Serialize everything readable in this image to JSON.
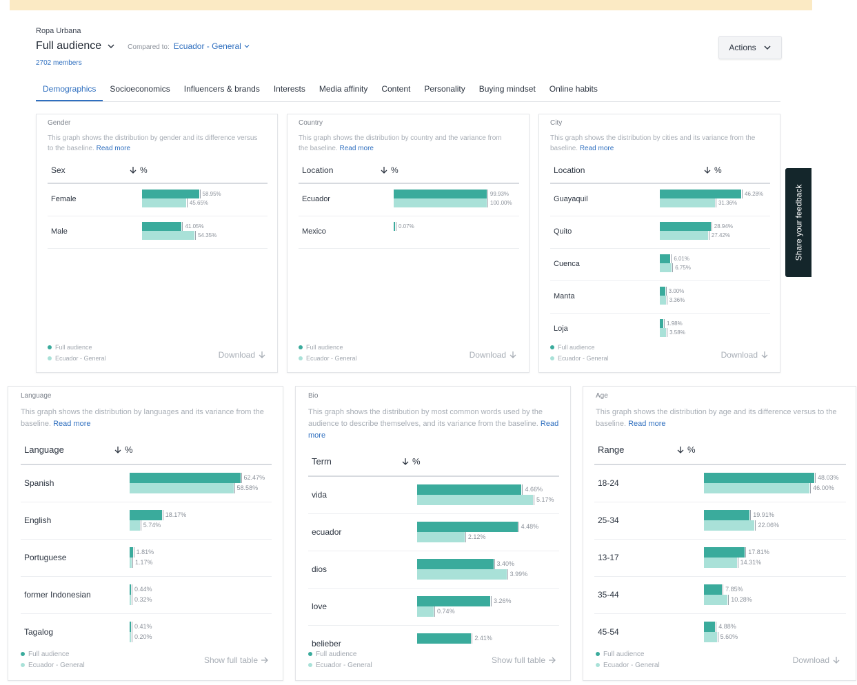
{
  "header": {
    "brand": "Ropa Urbana",
    "audience": "Full audience",
    "compared_label": "Compared to:",
    "compared_value": "Ecuador - General",
    "members": "2702 members",
    "actions_label": "Actions"
  },
  "tabs": [
    {
      "label": "Demographics",
      "active": true
    },
    {
      "label": "Socioeconomics",
      "active": false
    },
    {
      "label": "Influencers & brands",
      "active": false
    },
    {
      "label": "Interests",
      "active": false
    },
    {
      "label": "Media affinity",
      "active": false
    },
    {
      "label": "Content",
      "active": false
    },
    {
      "label": "Personality",
      "active": false
    },
    {
      "label": "Buying mindset",
      "active": false
    },
    {
      "label": "Online habits",
      "active": false
    }
  ],
  "feedback": {
    "label": "Share your feedback"
  },
  "colors": {
    "full": "#3aab9c",
    "base": "#a9e1d8",
    "accent": "#2f6fbf",
    "feedback_bg": "#14262b"
  },
  "legend": {
    "full": "Full audience",
    "base": "Ecuador - General"
  },
  "cards": [
    {
      "id": "gender",
      "title": "Gender",
      "desc": "This graph shows the distribution by gender and its difference versus to the baseline.",
      "read_more": "Read more",
      "col_label": "Sex",
      "pct_label": "%",
      "link": "Download",
      "link_icon": "download-icon",
      "rows": [
        {
          "label": "Female",
          "full": 58.95,
          "base": 45.65,
          "full_text": "58.95%",
          "base_text": "45.65%"
        },
        {
          "label": "Male",
          "full": 41.05,
          "base": 54.35,
          "full_text": "41.05%",
          "base_text": "54.35%"
        }
      ]
    },
    {
      "id": "country",
      "title": "Country",
      "desc": "This graph shows the distribution by country and the variance from the baseline.",
      "read_more": "Read more",
      "col_label": "Location",
      "pct_label": "%",
      "link": "Download",
      "link_icon": "download-icon",
      "rows": [
        {
          "label": "Ecuador",
          "full": 99.93,
          "base": 100.0,
          "full_text": "99.93%",
          "base_text": "100.00%"
        },
        {
          "label": "Mexico",
          "full": 0.07,
          "base": null,
          "full_text": "0.07%",
          "base_text": null
        }
      ]
    },
    {
      "id": "city",
      "title": "City",
      "desc": "This graph shows the distribution by cities and its variance from the baseline.",
      "read_more": "Read more",
      "col_label": "Location",
      "pct_label": "%",
      "link": "Download",
      "link_icon": "download-icon",
      "rows": [
        {
          "label": "Guayaquil",
          "full": 46.28,
          "base": 31.36,
          "full_text": "46.28%",
          "base_text": "31.36%"
        },
        {
          "label": "Quito",
          "full": 28.94,
          "base": 27.42,
          "full_text": "28.94%",
          "base_text": "27.42%"
        },
        {
          "label": "Cuenca",
          "full": 6.01,
          "base": 6.75,
          "full_text": "6.01%",
          "base_text": "6.75%"
        },
        {
          "label": "Manta",
          "full": 3.0,
          "base": 3.36,
          "full_text": "3.00%",
          "base_text": "3.36%"
        },
        {
          "label": "Loja",
          "full": 1.98,
          "base": 3.58,
          "full_text": "1.98%",
          "base_text": "3.58%"
        }
      ]
    },
    {
      "id": "language",
      "title": "Language",
      "desc": "This graph shows the distribution by languages and its variance from the baseline.",
      "read_more": "Read more",
      "col_label": "Language",
      "pct_label": "%",
      "link": "Show full table",
      "link_icon": "arrow-right-icon",
      "rows": [
        {
          "label": "Spanish",
          "full": 62.47,
          "base": 58.58,
          "full_text": "62.47%",
          "base_text": "58.58%"
        },
        {
          "label": "English",
          "full": 18.17,
          "base": 5.74,
          "full_text": "18.17%",
          "base_text": "5.74%"
        },
        {
          "label": "Portuguese",
          "full": 1.81,
          "base": 1.17,
          "full_text": "1.81%",
          "base_text": "1.17%"
        },
        {
          "label": "former Indonesian",
          "full": 0.44,
          "base": 0.32,
          "full_text": "0.44%",
          "base_text": "0.32%"
        },
        {
          "label": "Tagalog",
          "full": 0.41,
          "base": 0.2,
          "full_text": "0.41%",
          "base_text": "0.20%"
        }
      ]
    },
    {
      "id": "bio",
      "title": "Bio",
      "desc": "This graph shows the distribution by most common words used by the audience to describe themselves, and its variance from the baseline.",
      "read_more": "Read more",
      "col_label": "Term",
      "pct_label": "%",
      "link": "Show full table",
      "link_icon": "arrow-right-icon",
      "rows": [
        {
          "label": "vida",
          "full": 4.66,
          "base": 5.17,
          "full_text": "4.66%",
          "base_text": "5.17%"
        },
        {
          "label": "ecuador",
          "full": 4.48,
          "base": 2.12,
          "full_text": "4.48%",
          "base_text": "2.12%"
        },
        {
          "label": "dios",
          "full": 3.4,
          "base": 3.99,
          "full_text": "3.40%",
          "base_text": "3.99%"
        },
        {
          "label": "love",
          "full": 3.26,
          "base": 0.74,
          "full_text": "3.26%",
          "base_text": "0.74%"
        },
        {
          "label": "belieber",
          "full": 2.41,
          "base": null,
          "full_text": "2.41%",
          "base_text": null
        }
      ]
    },
    {
      "id": "age",
      "title": "Age",
      "desc": "This graph shows the distribution by age and its difference versus to the baseline.",
      "read_more": "Read more",
      "col_label": "Range",
      "pct_label": "%",
      "link": "Download",
      "link_icon": "download-icon",
      "rows": [
        {
          "label": "18-24",
          "full": 48.03,
          "base": 46.0,
          "full_text": "48.03%",
          "base_text": "46.00%"
        },
        {
          "label": "25-34",
          "full": 19.91,
          "base": 22.06,
          "full_text": "19.91%",
          "base_text": "22.06%"
        },
        {
          "label": "13-17",
          "full": 17.81,
          "base": 14.31,
          "full_text": "17.81%",
          "base_text": "14.31%"
        },
        {
          "label": "35-44",
          "full": 7.85,
          "base": 10.28,
          "full_text": "7.85%",
          "base_text": "10.28%"
        },
        {
          "label": "45-54",
          "full": 4.88,
          "base": 5.6,
          "full_text": "4.88%",
          "base_text": "5.60%"
        }
      ]
    }
  ]
}
